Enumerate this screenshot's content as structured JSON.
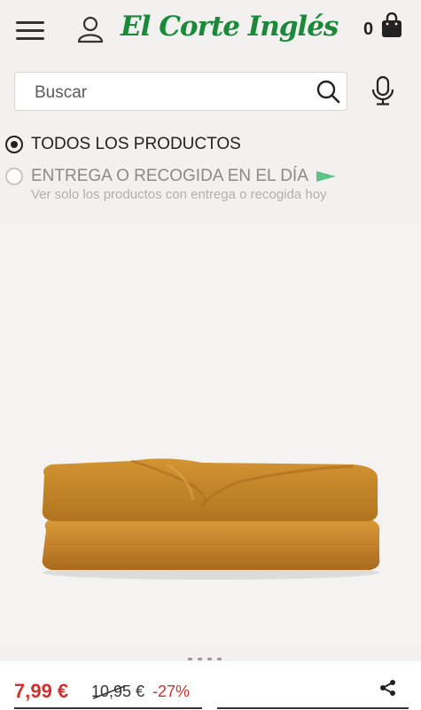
{
  "header": {
    "menu_icon": "hamburger-menu-icon",
    "user_icon": "user-icon",
    "logo_text": "El Corte Inglés",
    "cart_count": "0",
    "cart_icon": "shopping-bag-icon",
    "brand_color": "#1a8a3a"
  },
  "search": {
    "placeholder": "Buscar",
    "value": "",
    "search_icon": "search-icon",
    "mic_icon": "microphone-icon"
  },
  "filters": {
    "options": [
      {
        "label": "TODOS LOS PRODUCTOS",
        "selected": true
      },
      {
        "label": "ENTREGA O RECOGIDA EN EL DÍA",
        "selected": false,
        "icon": "green-flag-icon"
      }
    ],
    "subtext": "Ver solo los productos con entrega o recogida hoy"
  },
  "product": {
    "image": "folded-mustard-fleece-blanket",
    "price": "7,99 €",
    "old_price": "10,95 €",
    "discount": "-27%",
    "price_color": "#d0312d",
    "share_icon": "share-icon"
  }
}
